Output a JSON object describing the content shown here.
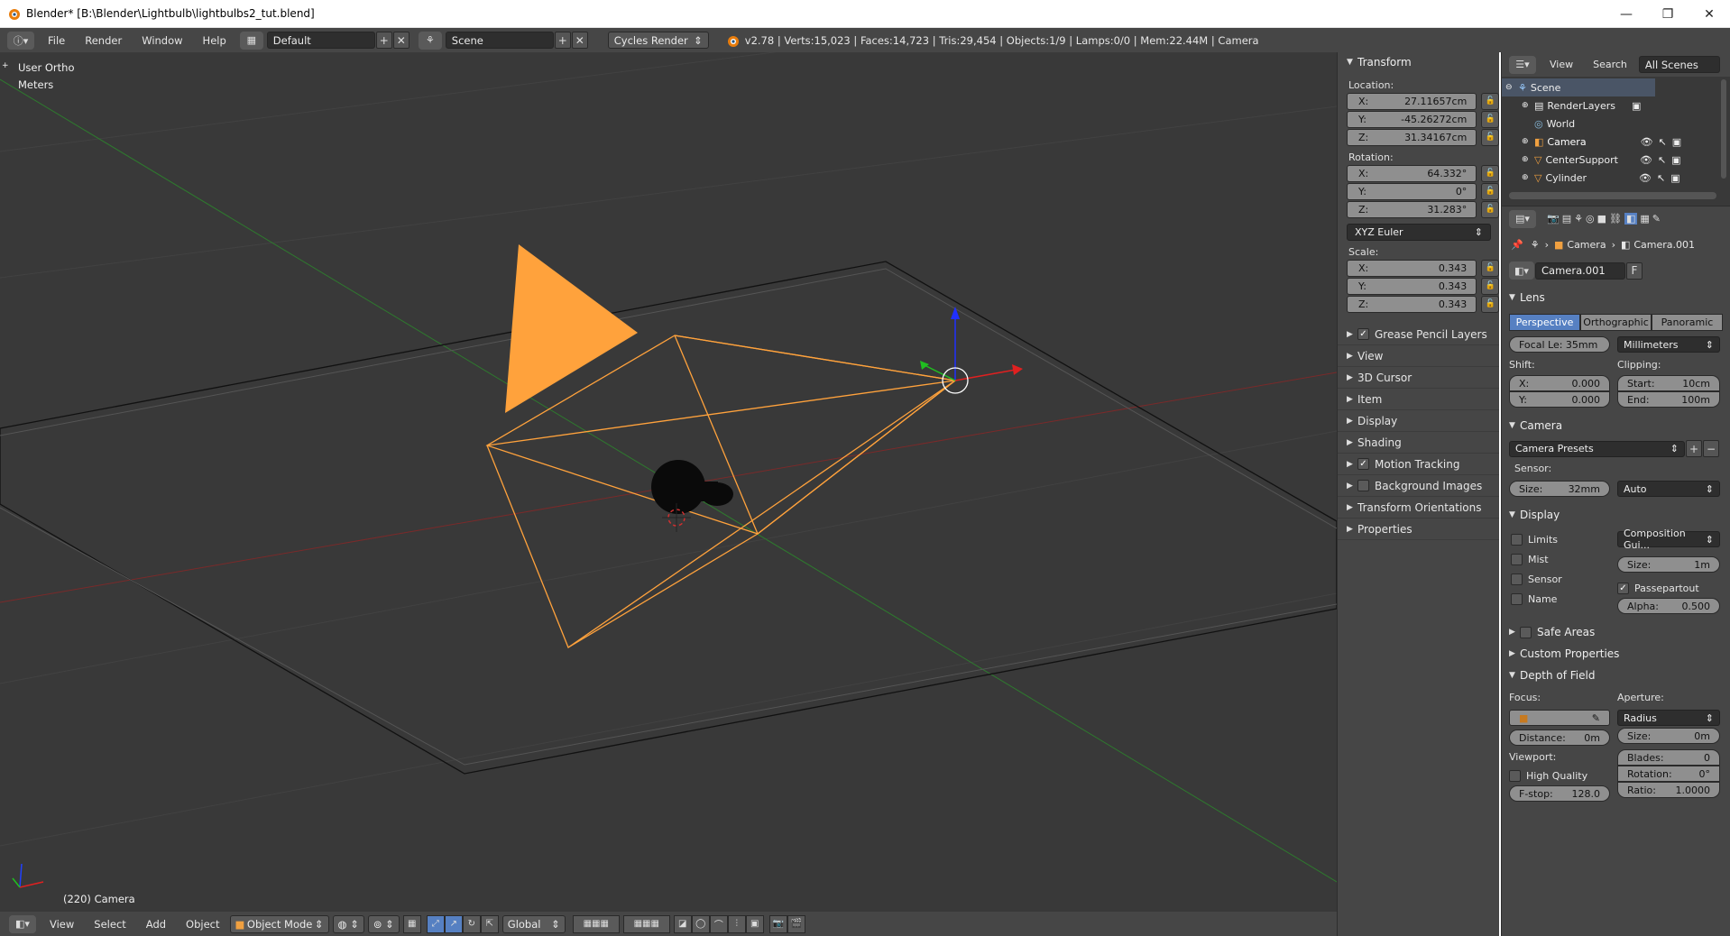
{
  "window": {
    "title": "Blender* [B:\\Blender\\Lightbulb\\lightbulbs2_tut.blend]",
    "min_glyph": "—",
    "max_glyph": "❐",
    "close_glyph": "✕"
  },
  "info_header": {
    "menus": [
      "File",
      "Render",
      "Window",
      "Help"
    ],
    "screen_layout": "Default",
    "scene": "Scene",
    "render_engine": "Cycles Render",
    "stats": "v2.78 | Verts:15,023 | Faces:14,723 | Tris:29,454 | Objects:1/9 | Lamps:0/0 | Mem:22.44M | Camera"
  },
  "viewport": {
    "view_name": "User Ortho",
    "units": "Meters",
    "object_label": "(220) Camera",
    "colors": {
      "background": "#393939",
      "camera": "#ffaa3c",
      "x_axis": "#d43030",
      "y_axis": "#30c030",
      "z_axis": "#2040ff"
    }
  },
  "viewport_footer": {
    "menus": [
      "View",
      "Select",
      "Add",
      "Object"
    ],
    "mode": "Object Mode",
    "orientation": "Global"
  },
  "npanel": {
    "transform_title": "Transform",
    "location_label": "Location:",
    "location": {
      "x": "27.11657cm",
      "y": "-45.26272cm",
      "z": "31.34167cm"
    },
    "rotation_label": "Rotation:",
    "rotation": {
      "x": "64.332°",
      "y": "0°",
      "z": "31.283°"
    },
    "rotation_mode": "XYZ Euler",
    "scale_label": "Scale:",
    "scale": {
      "x": "0.343",
      "y": "0.343",
      "z": "0.343"
    },
    "axis_x": "X:",
    "axis_y": "Y:",
    "axis_z": "Z:",
    "sections": [
      {
        "label": "Grease Pencil Layers",
        "checkbox": true
      },
      {
        "label": "View",
        "checkbox": false
      },
      {
        "label": "3D Cursor",
        "checkbox": false
      },
      {
        "label": "Item",
        "checkbox": false
      },
      {
        "label": "Display",
        "checkbox": false
      },
      {
        "label": "Shading",
        "checkbox": false
      },
      {
        "label": "Motion Tracking",
        "checkbox": true
      },
      {
        "label": "Background Images",
        "checkbox": false
      },
      {
        "label": "Transform Orientations",
        "checkbox": false
      },
      {
        "label": "Properties",
        "checkbox": false
      }
    ]
  },
  "outliner": {
    "menus": [
      "View",
      "Search"
    ],
    "filter": "All Scenes",
    "items": [
      {
        "label": "Scene"
      },
      {
        "label": "RenderLayers"
      },
      {
        "label": "World"
      },
      {
        "label": "Camera"
      },
      {
        "label": "CenterSupport"
      },
      {
        "label": "Cylinder"
      }
    ]
  },
  "properties": {
    "breadcrumb": {
      "object": "Camera",
      "data": "Camera.001"
    },
    "datablock": "Camera.001",
    "fake_user": "F",
    "lens": {
      "title": "Lens",
      "types": [
        "Perspective",
        "Orthographic",
        "Panoramic"
      ],
      "active_type": "Perspective",
      "focal": "Focal Le: 35mm",
      "lens_unit": "Millimeters",
      "shift_label": "Shift:",
      "shift_x": "0.000",
      "shift_y": "0.000",
      "clipping_label": "Clipping:",
      "clip_start_label": "Start:",
      "clip_start": "10cm",
      "clip_end_label": "End:",
      "clip_end": "100m"
    },
    "camera": {
      "title": "Camera",
      "presets": "Camera Presets",
      "sensor_label": "Sensor:",
      "size_label": "Size:",
      "size": "32mm",
      "fit": "Auto"
    },
    "display": {
      "title": "Display",
      "options": [
        {
          "label": "Limits",
          "checked": false
        },
        {
          "label": "Mist",
          "checked": false
        },
        {
          "label": "Sensor",
          "checked": false
        },
        {
          "label": "Name",
          "checked": false
        }
      ],
      "guide": "Composition Gui...",
      "size_label": "Size:",
      "size": "1m",
      "passepartout": "Passepartout",
      "alpha_label": "Alpha:",
      "alpha": "0.500"
    },
    "safe_areas": "Safe Areas",
    "custom_props": "Custom Properties",
    "dof": {
      "title": "Depth of Field",
      "focus_label": "Focus:",
      "distance_label": "Distance:",
      "distance": "0m",
      "viewport_label": "Viewport:",
      "high_quality": "High Quality",
      "fstop_label": "F-stop:",
      "fstop": "128.0",
      "aperture_label": "Aperture:",
      "aperture_type": "Radius",
      "size_label": "Size:",
      "size": "0m",
      "blades_label": "Blades:",
      "blades": "0",
      "rotation_label": "Rotation:",
      "rotation": "0°",
      "ratio_label": "Ratio:",
      "ratio": "1.0000"
    }
  }
}
